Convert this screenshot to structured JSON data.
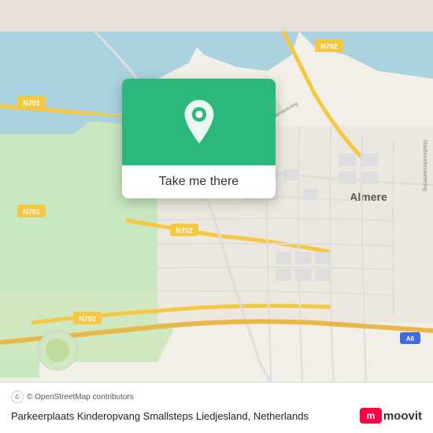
{
  "map": {
    "background_color": "#e8e0d8",
    "attribution": "© OpenStreetMap contributors"
  },
  "popup": {
    "button_label": "Take me there",
    "pin_color": "#2db87b"
  },
  "bottom_bar": {
    "location_name": "Parkeerplaats Kinderopvang Smallsteps Liedjesland,",
    "location_country": "Netherlands",
    "attribution_text": "© OpenStreetMap contributors",
    "moovit_label": "moovit"
  }
}
